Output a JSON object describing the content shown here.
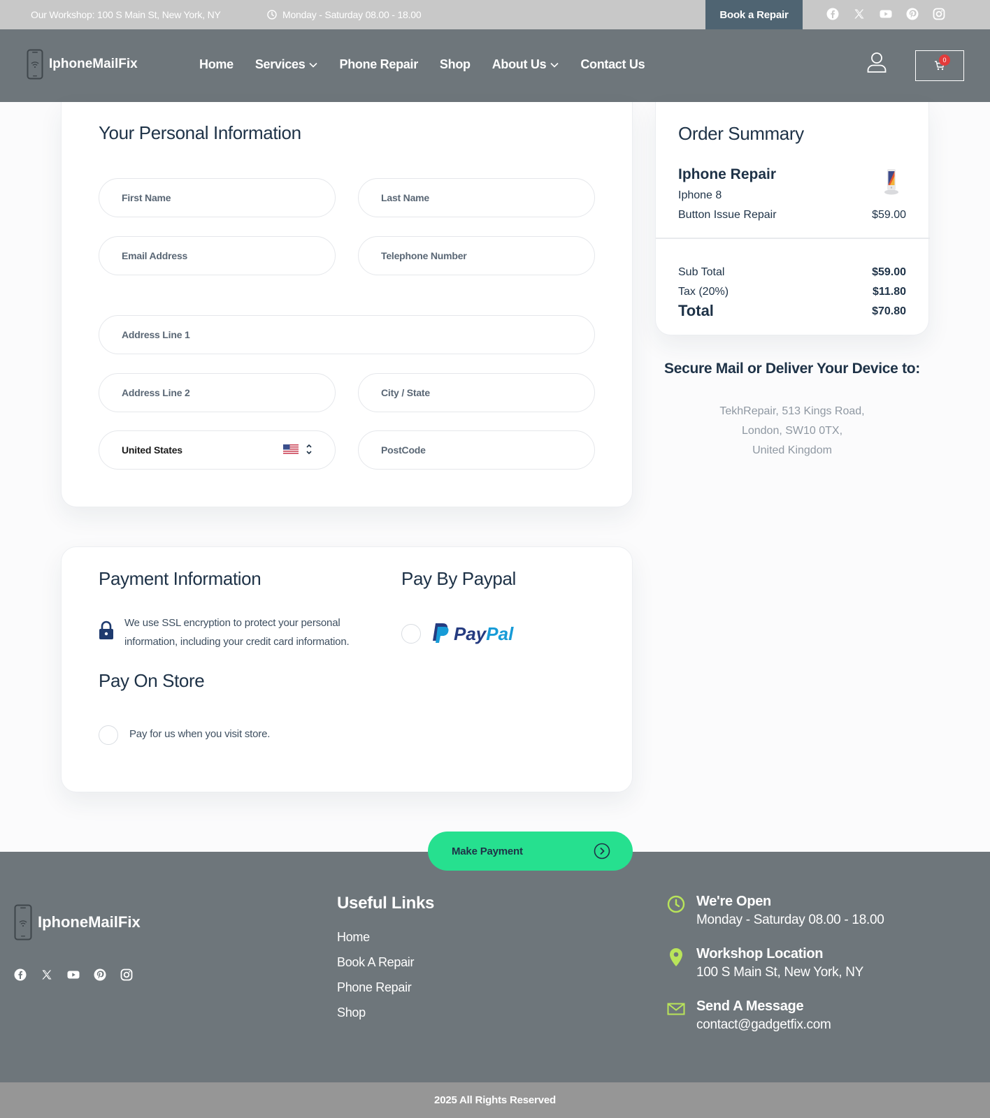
{
  "topbar": {
    "address": "Our Workshop: 100 S Main St, New York, NY",
    "hours": "Monday - Saturday 08.00 - 18.00",
    "book_label": "Book a Repair",
    "social": [
      "facebook-icon",
      "x-icon",
      "youtube-icon",
      "pinterest-icon",
      "instagram-icon"
    ]
  },
  "header": {
    "brand": "IphoneMailFix",
    "nav": [
      {
        "label": "Home",
        "dropdown": false
      },
      {
        "label": "Services",
        "dropdown": true
      },
      {
        "label": "Phone Repair",
        "dropdown": false
      },
      {
        "label": "Shop",
        "dropdown": false
      },
      {
        "label": "About Us",
        "dropdown": true
      },
      {
        "label": "Contact Us",
        "dropdown": false
      }
    ],
    "cart_count": "0"
  },
  "personal": {
    "title": "Your Personal Information",
    "first_name": "First Name",
    "last_name": "Last Name",
    "email": "Email Address",
    "phone": "Telephone Number",
    "address1": "Address Line 1",
    "address2": "Address Line 2",
    "city": "City / State",
    "country": "United States",
    "postcode": "PostCode"
  },
  "payment": {
    "title": "Payment Information",
    "ssl_text_1": "We use SSL encryption to protect your personal",
    "ssl_text_2": "information, including your credit card information.",
    "paypal_title": "Pay By Paypal",
    "paypal_brand_1": "Pay",
    "paypal_brand_2": "Pal",
    "store_title": "Pay On Store",
    "store_text": "Pay for us when you visit store."
  },
  "order": {
    "title": "Order Summary",
    "item_title": "Iphone Repair",
    "item_model": "Iphone 8",
    "item_service": "Button Issue Repair",
    "item_price": "$59.00",
    "subtotal_label": "Sub Total",
    "subtotal_value": "$59.00",
    "tax_label": "Tax (20%)",
    "tax_value": "$11.80",
    "total_label": "Total",
    "total_value": "$70.80"
  },
  "secure": {
    "title": "Secure Mail or Deliver Your Device to:",
    "line1": "TekhRepair, 513 Kings Road,",
    "line2": "London, SW10 0TX,",
    "line3": "United Kingdom"
  },
  "actions": {
    "make_payment": "Make Payment"
  },
  "footer": {
    "brand": "IphoneMailFix",
    "links_title": "Useful Links",
    "links": [
      "Home",
      "Book A Repair",
      "Phone Repair",
      "Shop"
    ],
    "open_title": "We're Open",
    "open_text": "Monday - Saturday 08.00 - 18.00",
    "location_title": "Workshop Location",
    "location_text": "100 S Main St, New York, NY",
    "message_title": "Send A Message",
    "message_text": "contact@gadgetfix.com",
    "copyright": "2025 All Rights Reserved"
  },
  "colors": {
    "accent": "#26e08f",
    "header_bg": "#6e767b",
    "topbar_bg": "#c8c8c8",
    "book_bg": "#4f6472",
    "heading": "#1e3247",
    "footer_icon": "#b9e45a"
  }
}
